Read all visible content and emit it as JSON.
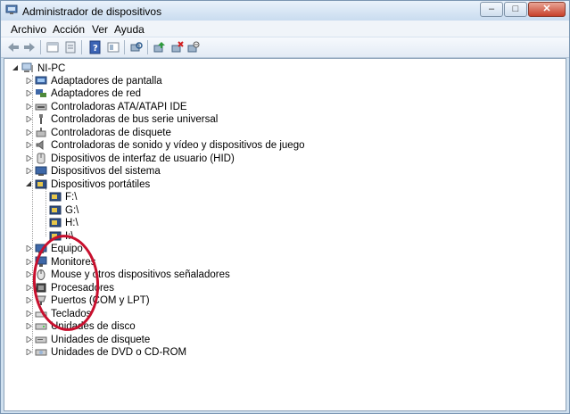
{
  "window": {
    "title": "Administrador de dispositivos"
  },
  "menu": [
    "Archivo",
    "Acción",
    "Ver",
    "Ayuda"
  ],
  "tree": {
    "root": "NI-PC",
    "categories": [
      "Adaptadores de pantalla",
      "Adaptadores de red",
      "Controladoras ATA/ATAPI IDE",
      "Controladoras de bus serie universal",
      "Controladoras de disquete",
      "Controladoras de sonido y vídeo y dispositivos de juego",
      "Dispositivos de interfaz de usuario (HID)",
      "Dispositivos del sistema",
      "Dispositivos portátiles",
      "Equipo",
      "Monitores",
      "Mouse y otros dispositivos señaladores",
      "Procesadores",
      "Puertos (COM y LPT)",
      "Teclados",
      "Unidades de disco",
      "Unidades de disquete",
      "Unidades de DVD o CD-ROM"
    ],
    "portable_devices": [
      "F:\\",
      "G:\\",
      "H:\\",
      "I:\\"
    ]
  },
  "colors": {
    "annotation_circle": "#c8102e"
  }
}
